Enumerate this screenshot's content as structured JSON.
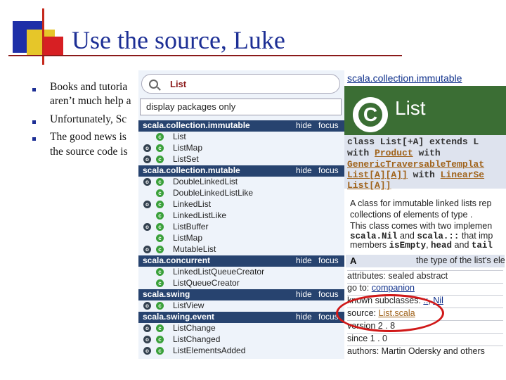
{
  "slide": {
    "title": "Use the source, Luke",
    "bullets": [
      "Books and tutoria",
      "aren’t much help a",
      "Unfortunately, Sc",
      "The good news is",
      "the source code is"
    ]
  },
  "search": {
    "value": "List",
    "filter_label": "display packages only"
  },
  "packages": [
    {
      "name": "scala.collection.immutable",
      "hide": "hide",
      "focus": "focus",
      "entries": [
        {
          "label": "List",
          "object": false
        },
        {
          "label": "ListMap",
          "object": true
        },
        {
          "label": "ListSet",
          "object": true
        }
      ]
    },
    {
      "name": "scala.collection.mutable",
      "hide": "hide",
      "focus": "focus",
      "entries": [
        {
          "label": "DoubleLinkedList",
          "object": true
        },
        {
          "label": "DoubleLinkedListLike",
          "object": false
        },
        {
          "label": "LinkedList",
          "object": true
        },
        {
          "label": "LinkedListLike",
          "object": false
        },
        {
          "label": "ListBuffer",
          "object": true
        },
        {
          "label": "ListMap",
          "object": false
        },
        {
          "label": "MutableList",
          "object": true
        }
      ]
    },
    {
      "name": "scala.concurrent",
      "hide": "hide",
      "focus": "focus",
      "entries": [
        {
          "label": "LinkedListQueueCreator",
          "object": false
        },
        {
          "label": "ListQueueCreator",
          "object": false
        }
      ]
    },
    {
      "name": "scala.swing",
      "hide": "hide",
      "focus": "focus",
      "entries": [
        {
          "label": "ListView",
          "object": true
        }
      ]
    },
    {
      "name": "scala.swing.event",
      "hide": "hide",
      "focus": "focus",
      "entries": [
        {
          "label": "ListChange",
          "object": true
        },
        {
          "label": "ListChanged",
          "object": true
        },
        {
          "label": "ListElementsAdded",
          "object": true
        }
      ]
    }
  ],
  "doc": {
    "breadcrumb": "scala.collection.immutable",
    "title": "List",
    "logo_letter": "C",
    "signature": {
      "line1": "class List[+A] extends L",
      "with": "with",
      "product": "Product",
      "with2": "with",
      "gtt": "GenericTraversableTemplat",
      "list_a_a": "List[A][A]]",
      "with3": "with",
      "linear": "Linear",
      "seq": "Se",
      "list_a": "List[A]]"
    },
    "description": [
      "A class for immutable linked lists rep",
      "collections of elements of type .",
      "This class comes with two implemen"
    ],
    "nil_line": {
      "mono1": "scala.Nil",
      "mid": " and ",
      "mono2": "scala.::",
      "tail": " that imp"
    },
    "members_line": {
      "pre": "members ",
      "mono1": "isEmpty",
      "mid": ", ",
      "mono2": "head",
      "and": " and ",
      "mono3": "tail"
    },
    "type_param": {
      "name": "A",
      "text": "the type of the list's ele"
    },
    "attributes": "attributes: sealed abstract",
    "goto_label": "go to: ",
    "goto_link": "companion",
    "subclasses_label": "known subclasses: ",
    "subclasses_link1": "::",
    "subclasses_sep": ", ",
    "subclasses_link2": "Nil",
    "source_label": "source: ",
    "source_link": "List.scala",
    "version": "version 2 . 8",
    "since": "since 1 . 0",
    "authors": "authors: Martin Odersky and others"
  },
  "colors": {
    "title": "#1d2f95",
    "package_header": "#27436f",
    "doc_header": "#3b6e34",
    "annotation": "#d01818"
  }
}
